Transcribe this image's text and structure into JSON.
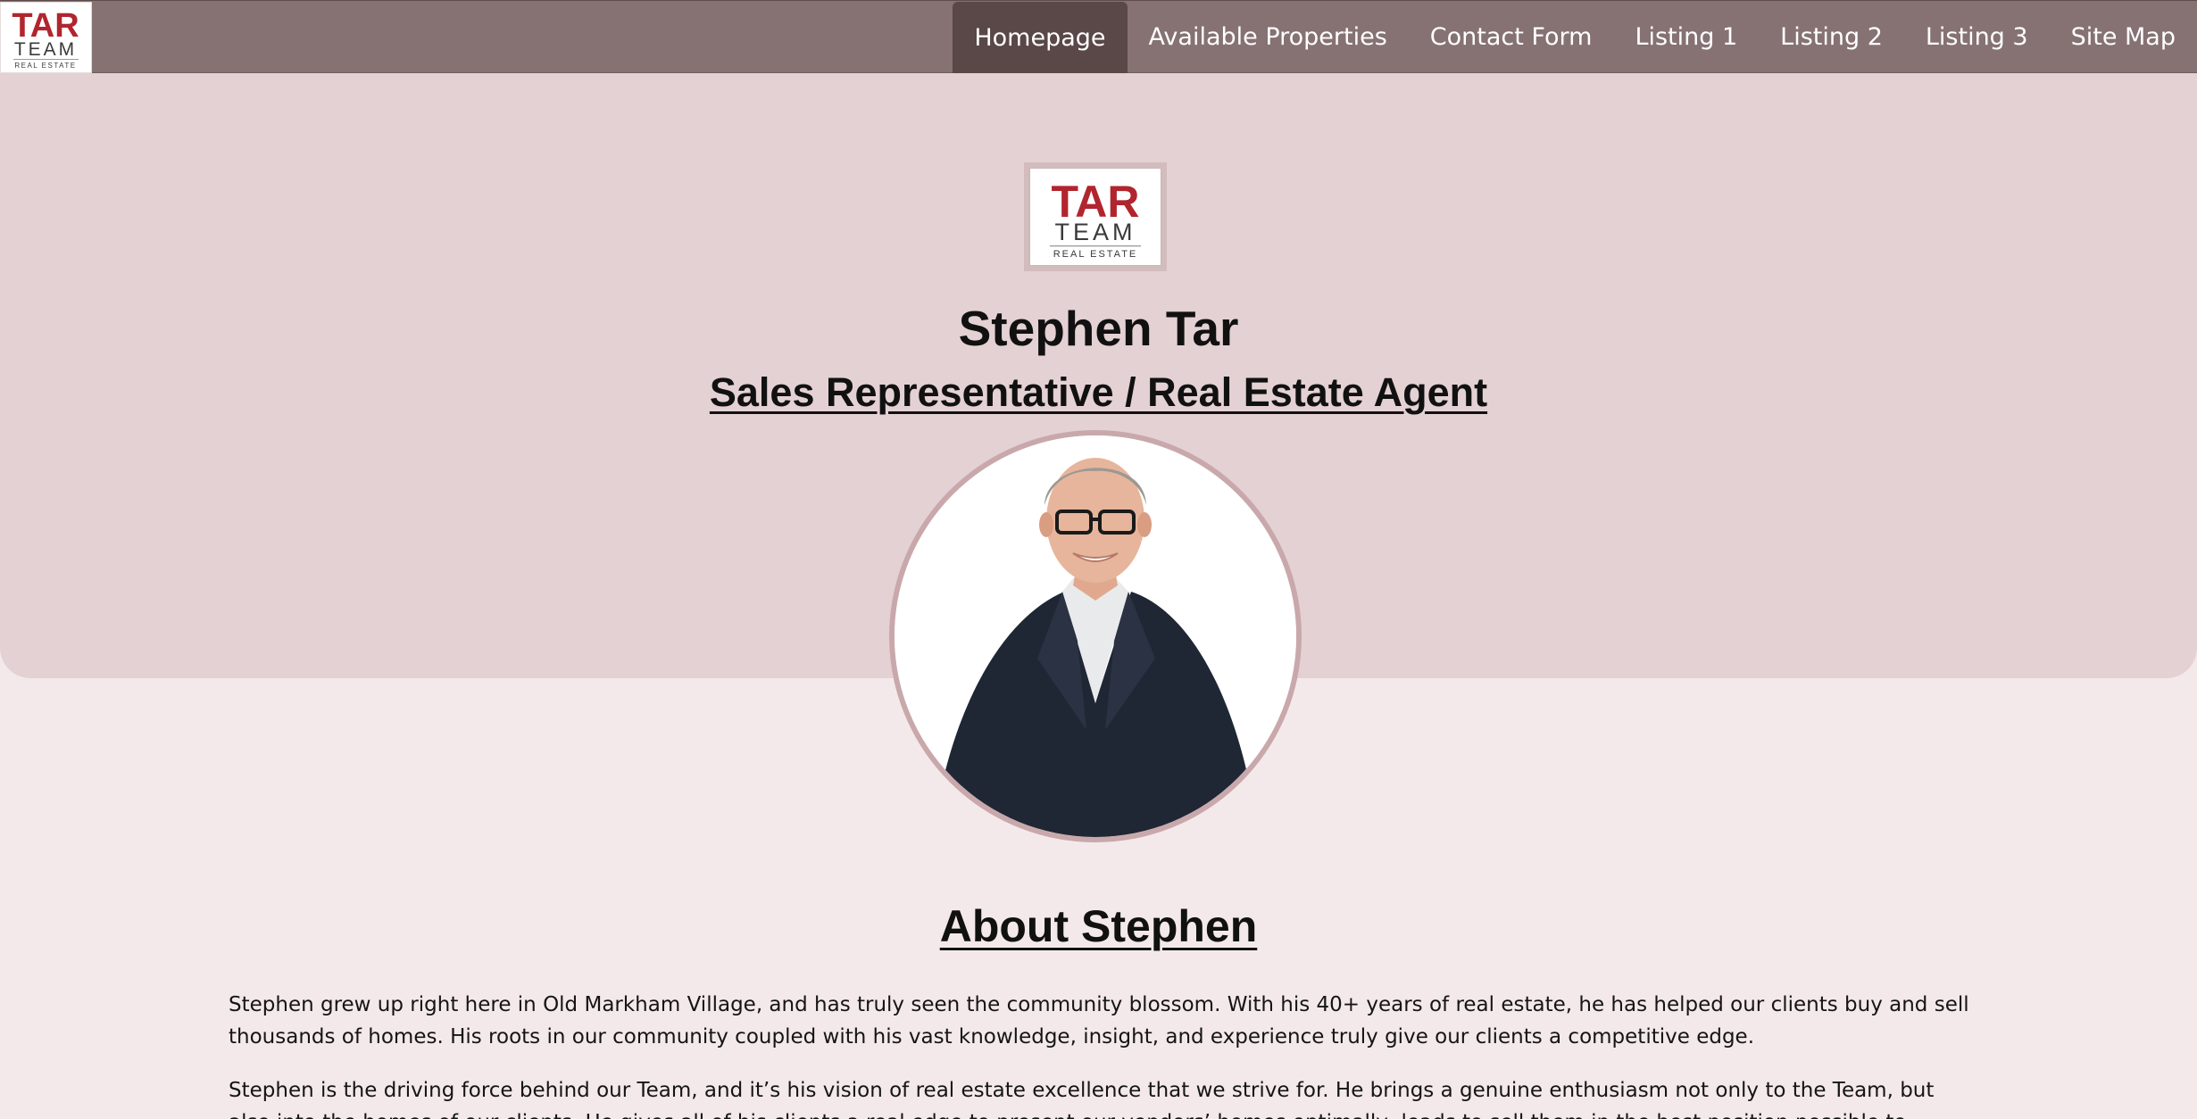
{
  "brand": {
    "logo_line1": "TAR",
    "logo_line2": "TEAM",
    "logo_line3": "REAL ESTATE",
    "primary_color": "#b1252e",
    "nav_bg": "#867273",
    "hero_bg": "#e4d1d3"
  },
  "nav": {
    "items": [
      {
        "label": "Homepage",
        "active": true
      },
      {
        "label": "Available Properties"
      },
      {
        "label": "Contact Form"
      },
      {
        "label": "Listing 1"
      },
      {
        "label": "Listing 2"
      },
      {
        "label": "Listing 3"
      },
      {
        "label": "Site Map"
      }
    ]
  },
  "hero": {
    "name": "Stephen Tar",
    "title": "Sales Representative / Real Estate Agent"
  },
  "about": {
    "heading": "About Stephen",
    "paragraphs": [
      "Stephen grew up right here in Old Markham Village, and has truly seen the community blossom. With his 40+ years of real estate, he has helped our clients buy and sell thousands of homes. His roots in our community coupled with his vast knowledge, insight, and experience truly give our clients a competitive edge.",
      "Stephen is the driving force behind our Team, and it’s his vision of real estate excellence that we strive for. He brings a genuine enthusiasm not only to the Team, but also into the homes of our clients. He gives all of his clients a real edge to present our vendors’ homes optimally, leads to sell them in the best position possible to achieve their goals. You’re truly in the"
    ]
  }
}
